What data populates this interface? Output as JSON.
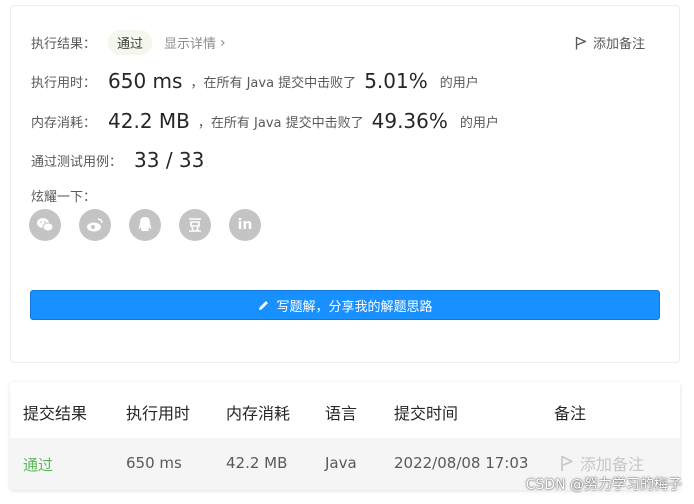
{
  "result": {
    "label": "执行结果：",
    "badge": "通过",
    "details_link": "显示详情",
    "add_note": "添加备注"
  },
  "runtime": {
    "label": "执行用时：",
    "value": "650 ms",
    "middle": "，在所有 Java 提交中击败了",
    "percent": "5.01%",
    "suffix": "的用户"
  },
  "memory": {
    "label": "内存消耗：",
    "value": "42.2 MB",
    "middle": "，在所有 Java 提交中击败了",
    "percent": "49.36%",
    "suffix": "的用户"
  },
  "testcases": {
    "label": "通过测试用例：",
    "value": "33 / 33"
  },
  "share": {
    "label": "炫耀一下：",
    "icons": [
      "wechat-icon",
      "weibo-icon",
      "qq-icon",
      "douban-icon",
      "linkedin-icon"
    ]
  },
  "write_solution_button": "写题解，分享我的解题思路",
  "table": {
    "headers": [
      "提交结果",
      "执行用时",
      "内存消耗",
      "语言",
      "提交时间",
      "备注"
    ],
    "row": {
      "result": "通过",
      "runtime": "650 ms",
      "memory": "42.2 MB",
      "language": "Java",
      "time": "2022/08/08 17:03",
      "note": "添加备注"
    }
  },
  "watermark": "CSDN @努力学习的梅子",
  "colors": {
    "primary": "#1890ff",
    "pass_green": "#5cb85c",
    "share_gray": "#c4c4c4"
  }
}
